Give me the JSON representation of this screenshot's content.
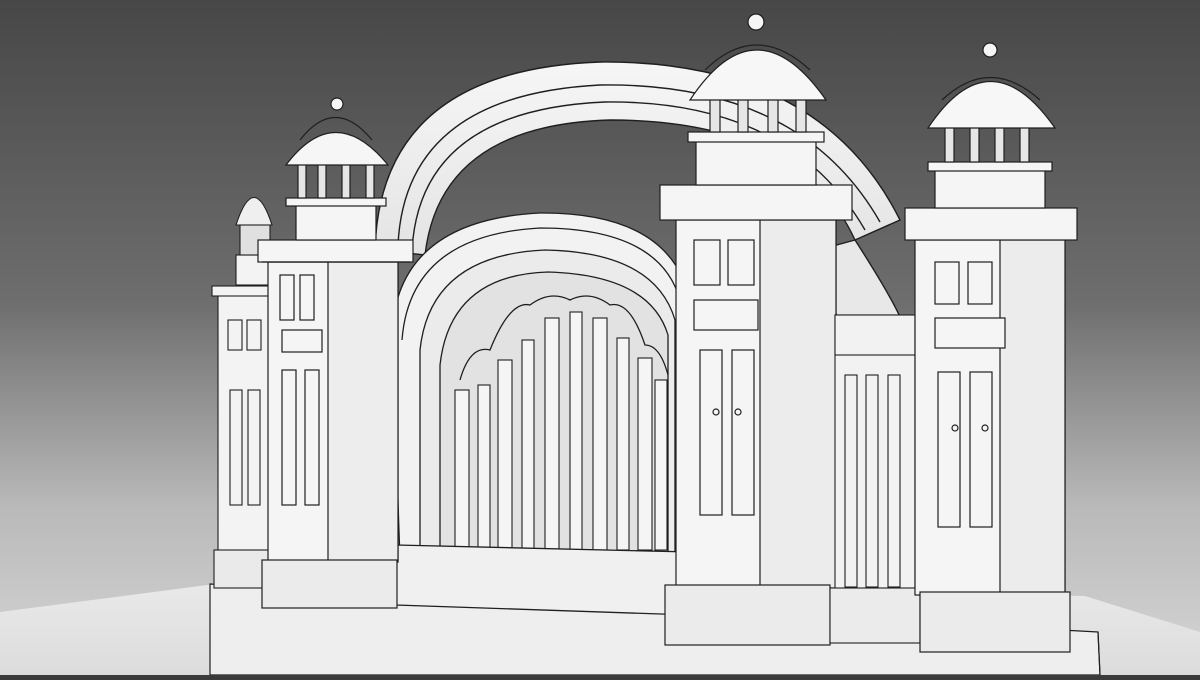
{
  "scene": {
    "subject": "ornamental-arched-gateway-model",
    "render_style": "clay-render-outline",
    "colors": {
      "background_top": "#4a4a4a",
      "background_bottom": "#d8d8d8",
      "floor": "#e6e6e6",
      "model_fill": "#f4f4f4",
      "model_shade": "#d9d9d9",
      "model_dark": "#bdbdbd",
      "outline": "#1f1f1f"
    }
  }
}
